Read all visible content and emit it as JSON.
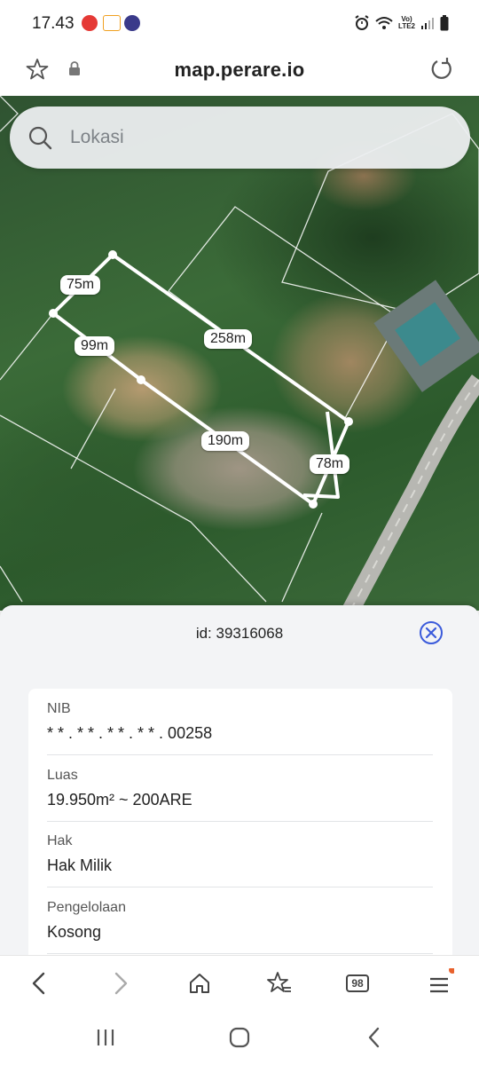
{
  "status_bar": {
    "time": "17.43",
    "network_line1": "Vo)",
    "network_line2": "LTE2"
  },
  "browser": {
    "url": "map.perare.io",
    "tab_count": "98"
  },
  "search": {
    "placeholder": "Lokasi"
  },
  "map": {
    "measurements": [
      "75m",
      "258m",
      "99m",
      "190m",
      "78m"
    ]
  },
  "panel": {
    "id_text": "id: 39316068",
    "fields": [
      {
        "label": "NIB",
        "value": "* * . * * . * * . * * . 00258"
      },
      {
        "label": "Luas",
        "value": "19.950m² ~ 200ARE"
      },
      {
        "label": "Hak",
        "value": "Hak Milik"
      },
      {
        "label": "Pengelolaan",
        "value": "Kosong"
      }
    ]
  },
  "colors": {
    "accent": "#3b5bdb",
    "notification_dot": "#e8612c"
  }
}
